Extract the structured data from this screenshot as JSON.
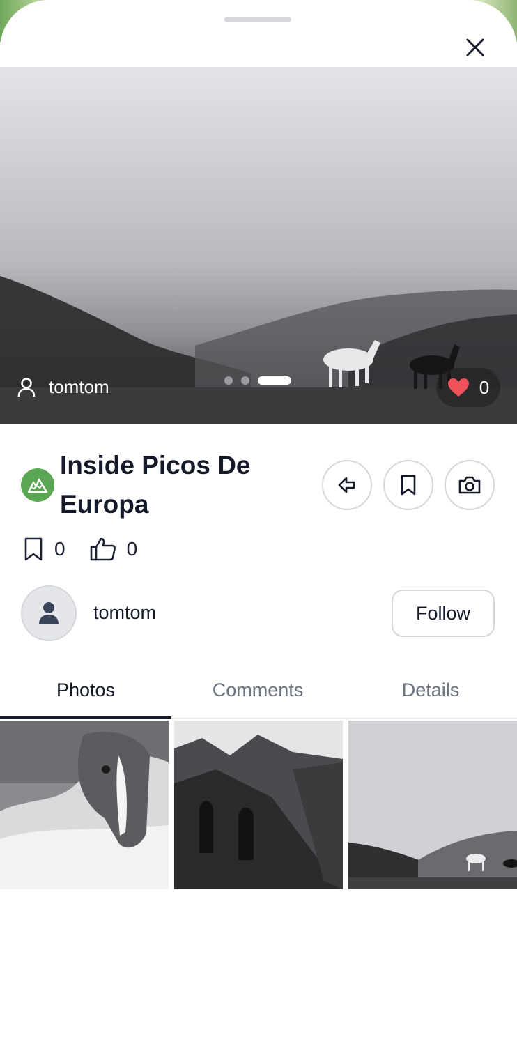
{
  "hero": {
    "author": "tomtom",
    "likes": "0",
    "slides_total": 3,
    "slide_active": 3
  },
  "route": {
    "title": "Inside Picos De Europa",
    "activity_icon": "mountain-icon",
    "bookmarks": "0",
    "thumbs_up": "0"
  },
  "author": {
    "name": "tomtom",
    "follow_label": "Follow"
  },
  "tabs": [
    {
      "label": "Photos",
      "active": true
    },
    {
      "label": "Comments",
      "active": false
    },
    {
      "label": "Details",
      "active": false
    }
  ],
  "photos": [
    {
      "subject": "horse-closeup"
    },
    {
      "subject": "stone-ruin-mountains"
    },
    {
      "subject": "horses-in-fog"
    }
  ],
  "colors": {
    "accent_green": "#5aa653",
    "heart_red": "#f0525a",
    "text_dark": "#141a2a",
    "tab_inactive": "#6b7280"
  }
}
